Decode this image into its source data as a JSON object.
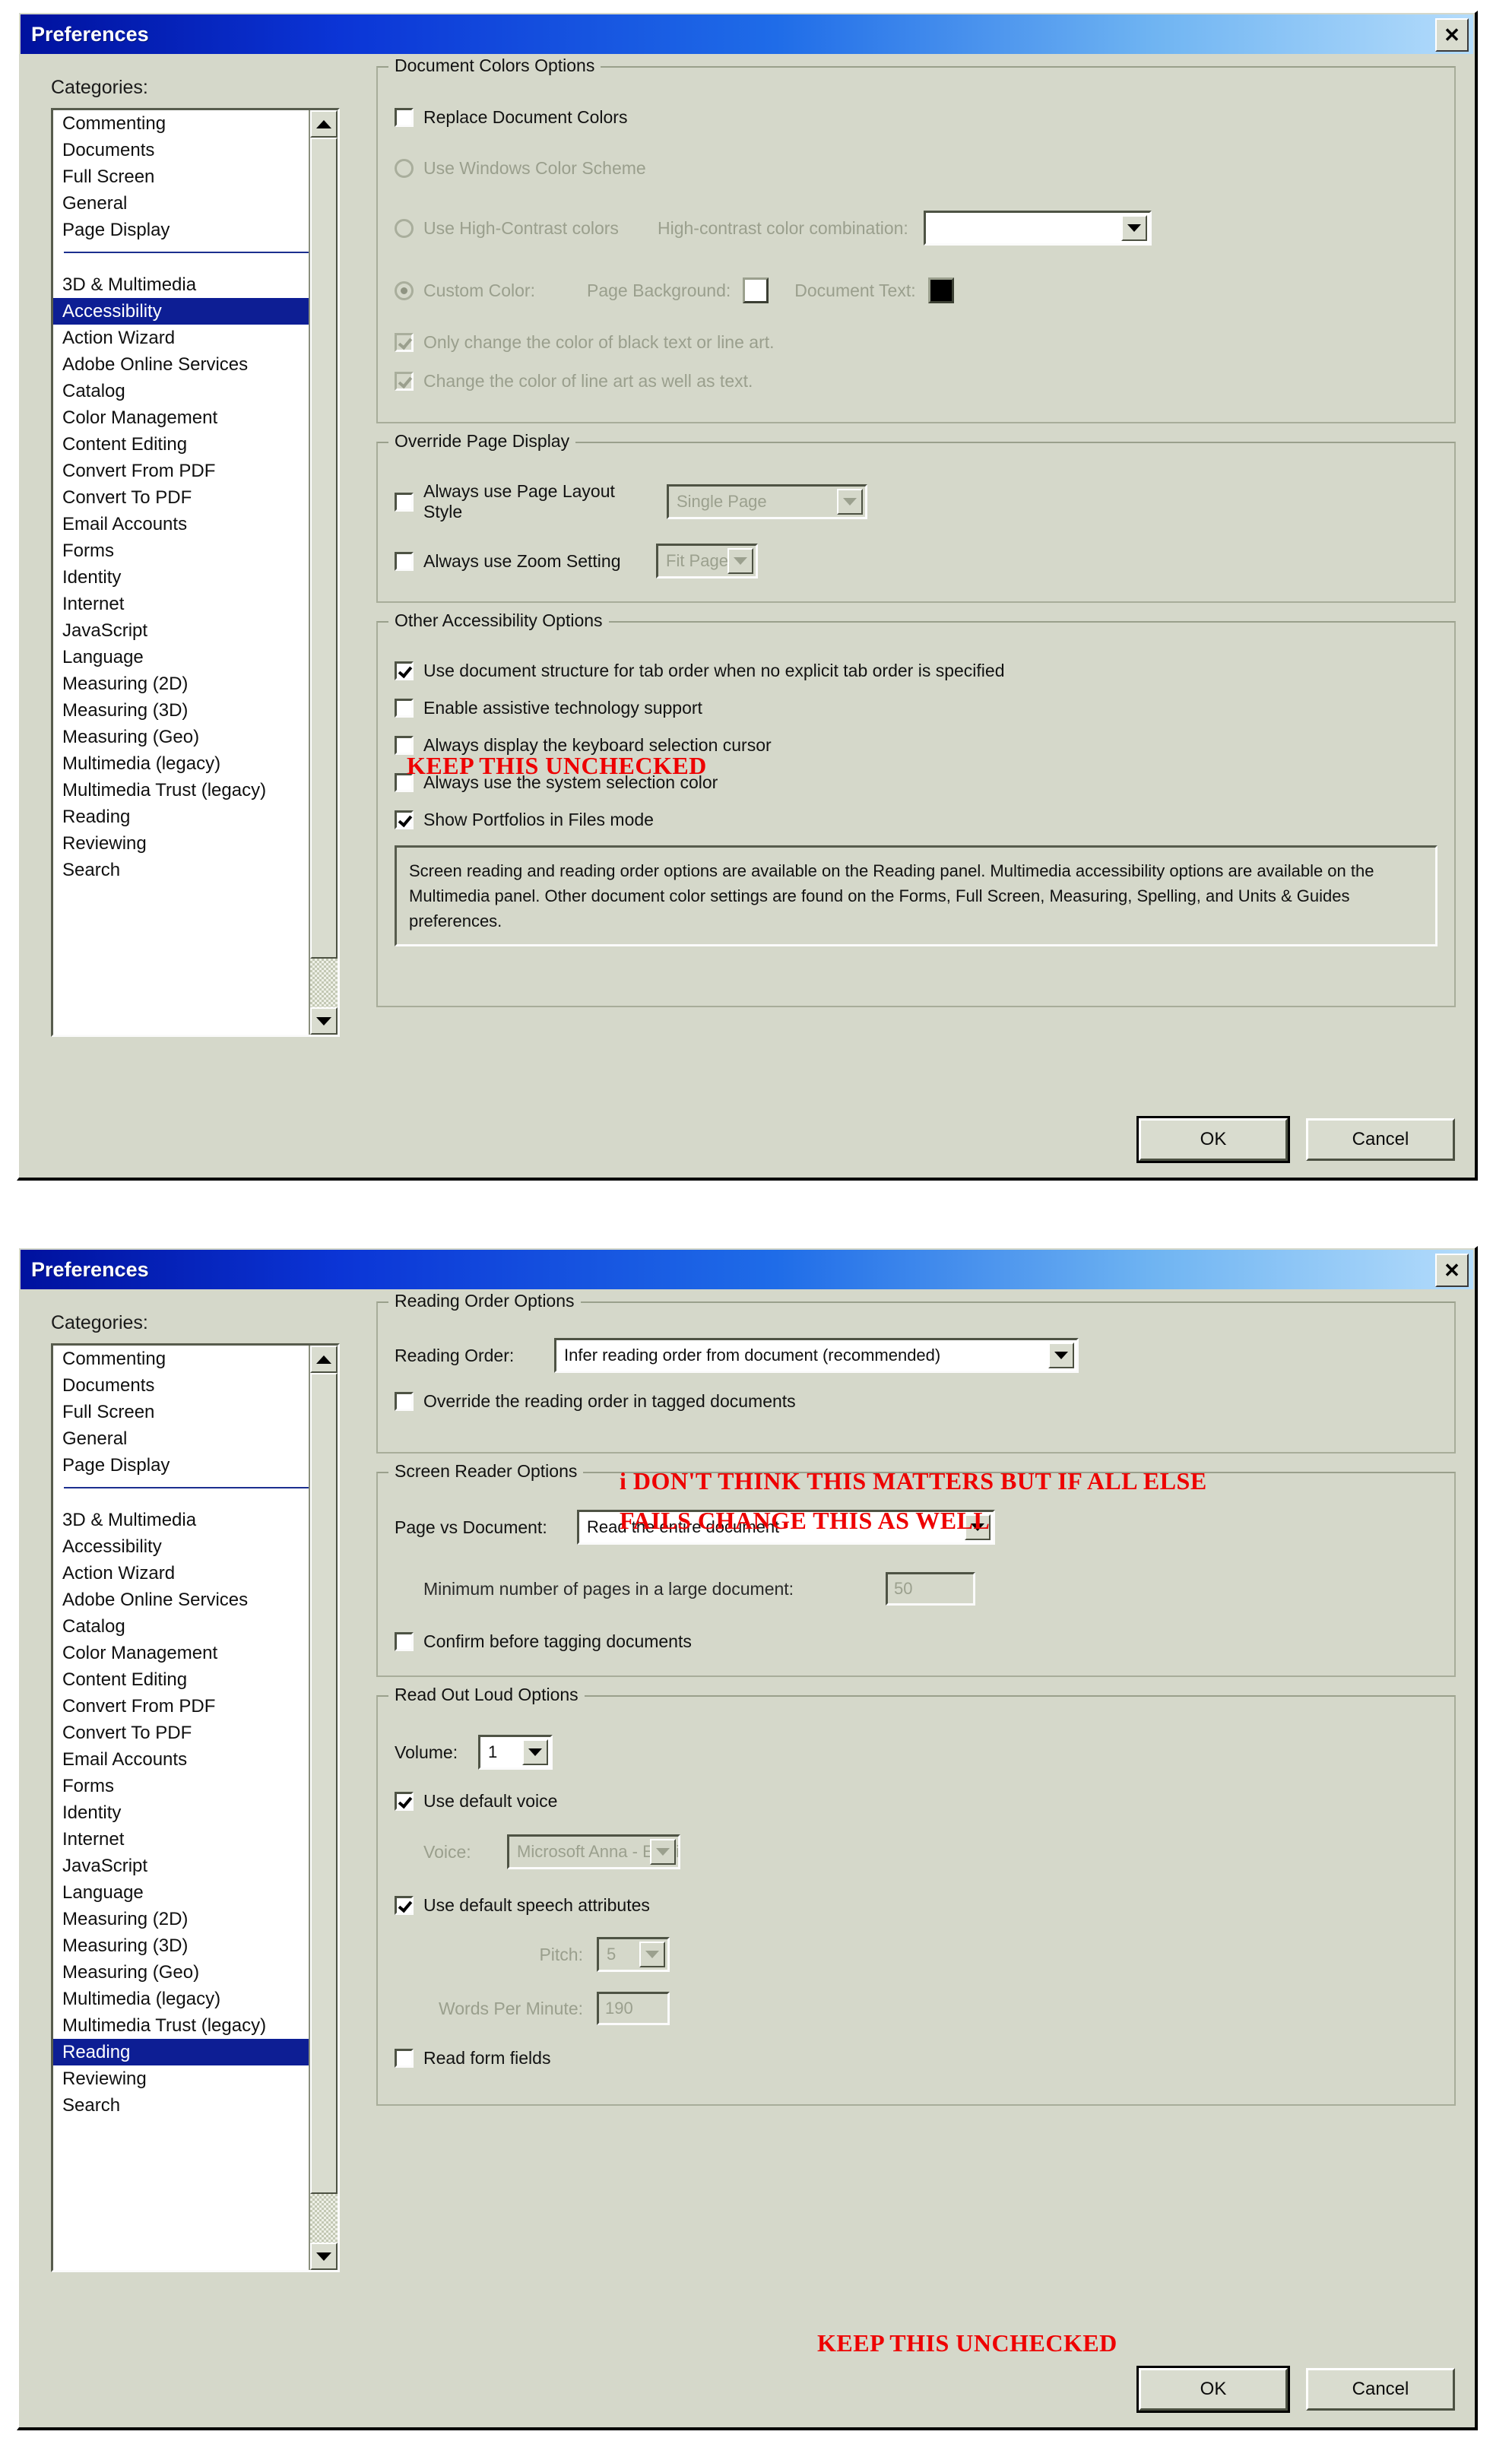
{
  "window": {
    "title": "Preferences",
    "close_icon": "close-icon",
    "ok_label": "OK",
    "cancel_label": "Cancel"
  },
  "categories": {
    "label": "Categories:",
    "items_top": [
      "Commenting",
      "Documents",
      "Full Screen",
      "General",
      "Page Display"
    ],
    "items_main": [
      "3D & Multimedia",
      "Accessibility",
      "Action Wizard",
      "Adobe Online Services",
      "Catalog",
      "Color Management",
      "Content Editing",
      "Convert From PDF",
      "Convert To PDF",
      "Email Accounts",
      "Forms",
      "Identity",
      "Internet",
      "JavaScript",
      "Language",
      "Measuring (2D)",
      "Measuring (3D)",
      "Measuring (Geo)",
      "Multimedia (legacy)",
      "Multimedia Trust (legacy)",
      "Reading",
      "Reviewing",
      "Search"
    ],
    "selected_dialog1": "Accessibility",
    "selected_dialog2": "Reading"
  },
  "dialog1": {
    "doc_colors": {
      "group_title": "Document Colors Options",
      "replace_document_colors": {
        "label": "Replace Document Colors",
        "checked": false
      },
      "use_windows_color_scheme": {
        "label": "Use Windows Color Scheme",
        "selected": false,
        "disabled": true
      },
      "use_high_contrast": {
        "label": "Use High-Contrast colors",
        "selected": false,
        "disabled": true
      },
      "high_contrast_combo_label": "High-contrast color combination:",
      "high_contrast_combo_value": "",
      "custom_color": {
        "label": "Custom Color:",
        "selected": true,
        "disabled": true
      },
      "page_background_label": "Page Background:",
      "page_background_color": "#ffffff",
      "document_text_label": "Document Text:",
      "document_text_color": "#000000",
      "only_change_black_text": {
        "label": "Only change the color of black text or line art.",
        "checked": true,
        "disabled": true
      },
      "change_line_art": {
        "label": "Change the color of line art as well as text.",
        "checked": true,
        "disabled": true
      }
    },
    "override_page_display": {
      "group_title": "Override Page Display",
      "always_page_layout": {
        "label": "Always use Page Layout Style",
        "checked": false
      },
      "page_layout_value": "Single Page",
      "always_zoom": {
        "label": "Always use Zoom Setting",
        "checked": false
      },
      "zoom_value": "Fit Page"
    },
    "other_accessibility": {
      "group_title": "Other Accessibility Options",
      "use_doc_structure": {
        "label": "Use document structure for tab order when no explicit tab order is specified",
        "checked": true
      },
      "enable_assistive": {
        "label": "Enable assistive technology support",
        "checked": false
      },
      "always_display_cursor": {
        "label": "Always display the keyboard selection cursor",
        "checked": false
      },
      "always_system_color": {
        "label": "Always use the system selection color",
        "checked": false
      },
      "show_portfolios": {
        "label": "Show Portfolios in Files mode",
        "checked": true
      },
      "info_text": "Screen reading and reading order options are available on the Reading panel. Multimedia accessibility options are available on the Multimedia panel. Other document color settings are found on the Forms, Full Screen, Measuring, Spelling, and Units & Guides preferences."
    },
    "annotation_1": "KEEP THIS UNCHECKED"
  },
  "dialog2": {
    "reading_order": {
      "group_title": "Reading Order Options",
      "reading_order_label": "Reading Order:",
      "reading_order_value": "Infer reading order from document (recommended)",
      "override_reading_order": {
        "label": "Override the reading order in tagged documents",
        "checked": false
      }
    },
    "screen_reader": {
      "group_title": "Screen Reader Options",
      "page_vs_document_label": "Page vs Document:",
      "page_vs_document_value": "Read the entire document",
      "min_pages_label": "Minimum number of pages in a large document:",
      "min_pages_value": "50",
      "confirm_before_tagging": {
        "label": "Confirm before tagging documents",
        "checked": false
      }
    },
    "read_out_loud": {
      "group_title": "Read Out Loud Options",
      "volume_label": "Volume:",
      "volume_value": "1",
      "use_default_voice": {
        "label": "Use default voice",
        "checked": true
      },
      "voice_label": "Voice:",
      "voice_value": "Microsoft Anna - Englis",
      "use_default_speech": {
        "label": "Use default speech attributes",
        "checked": true
      },
      "pitch_label": "Pitch:",
      "pitch_value": "5",
      "wpm_label": "Words Per Minute:",
      "wpm_value": "190",
      "read_form_fields": {
        "label": "Read form fields",
        "checked": false
      }
    },
    "annotation_1_line1": "i DON'T THINK THIS MATTERS BUT IF ALL ELSE",
    "annotation_1_line2": "FAILS CHANGE THIS AS WELL",
    "annotation_2": "KEEP THIS UNCHECKED"
  }
}
